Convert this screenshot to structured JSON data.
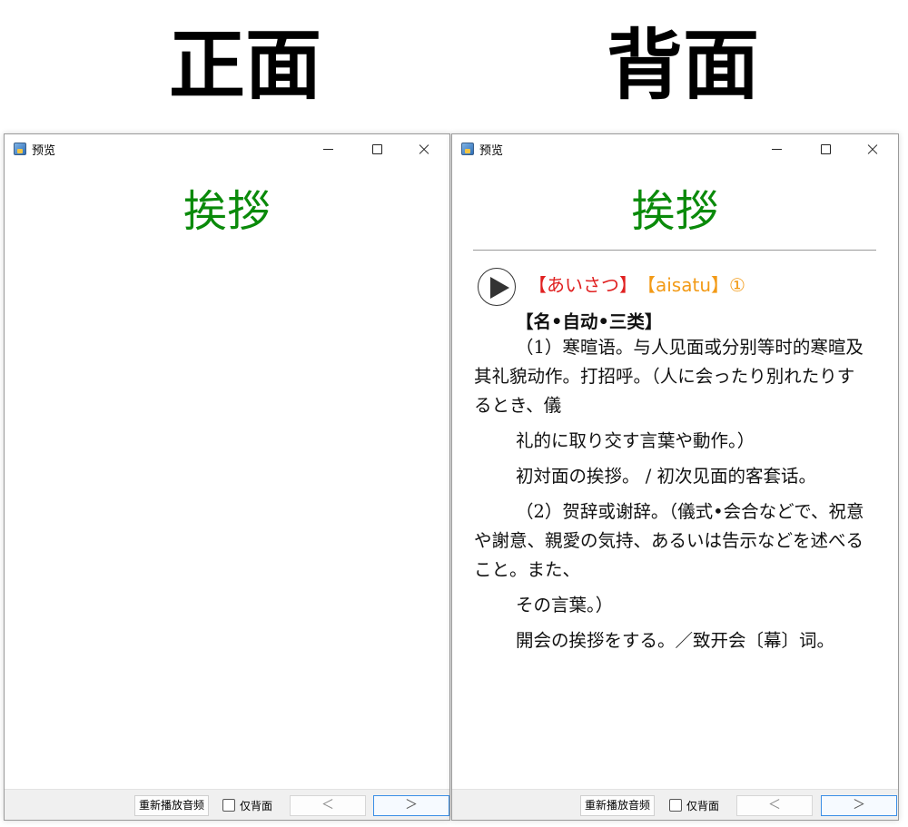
{
  "labels": {
    "front": "正面",
    "back": "背面"
  },
  "window": {
    "title": "预览",
    "buttons": {
      "minimize": "minimize",
      "maximize": "maximize",
      "close": "close"
    }
  },
  "card": {
    "word": "挨拶",
    "word_color": "#0a8a0a",
    "reading_kana": "【あいさつ】",
    "reading_romaji": "【aisatu】①",
    "kana_color": "#e02020",
    "romaji_color": "#f29a16",
    "pos": "【名•自动•三类】",
    "paragraphs": [
      "（1）寒暄语。与人见面或分别等时的寒暄及其礼貌动作。打招呼。（人に会ったり別れたりするとき、儀",
      "礼的に取り交す言葉や動作。）",
      "初対面の挨拶。 / 初次见面的客套话。",
      "（2）贺辞或谢辞。（儀式•会合などで、祝意や謝意、親愛の気持、あるいは告示などを述べること。また、",
      "その言葉。）",
      "開会の挨拶をする。／致开会〔幕〕词。"
    ]
  },
  "bottombar": {
    "replay_label": "重新播放音频",
    "back_only_label": "仅背面",
    "back_only_checked": false,
    "prev_label": "＜",
    "next_label": "＞"
  },
  "icons": {
    "app": "app-icon",
    "play": "play-icon"
  }
}
